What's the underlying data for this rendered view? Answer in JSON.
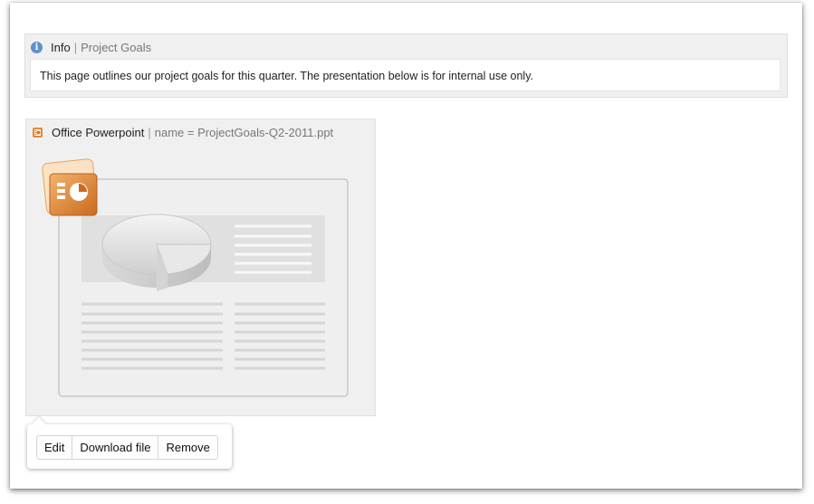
{
  "info_macro": {
    "title": "Info",
    "separator": "|",
    "subtitle": "Project Goals",
    "body": "This page outlines our project goals for this quarter. The presentation below is for internal use only.",
    "icon": "info-icon"
  },
  "office_macro": {
    "title": "Office Powerpoint",
    "separator": "|",
    "name_param": "name = ProjectGoals-Q2-2011.ppt",
    "icon": "powerpoint-icon",
    "accent": "#d2782e"
  },
  "toolbar": {
    "edit_label": "Edit",
    "download_label": "Download file",
    "remove_label": "Remove"
  }
}
